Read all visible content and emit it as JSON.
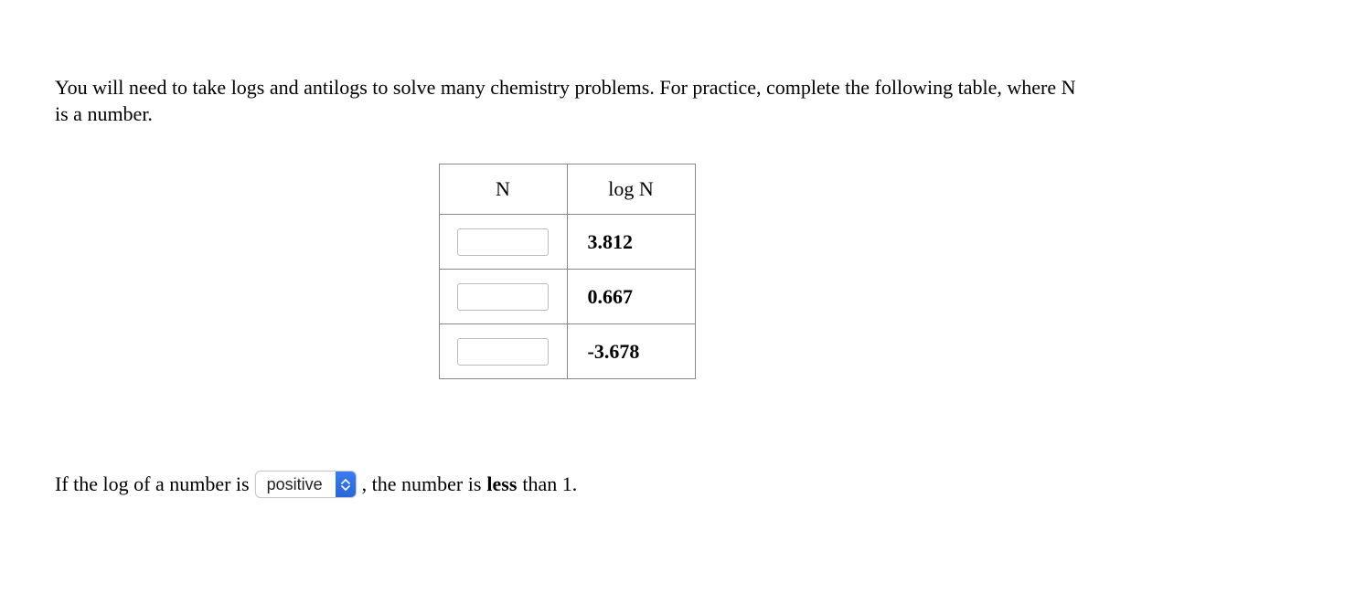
{
  "intro_text": "You will need to take logs and antilogs to solve many chemistry problems. For practice, complete the following table, where N is a number.",
  "table": {
    "headers": {
      "n": "N",
      "logn": "log N"
    },
    "rows": [
      {
        "n_value": "",
        "logn_value": "3.812"
      },
      {
        "n_value": "",
        "logn_value": "0.667"
      },
      {
        "n_value": "",
        "logn_value": "-3.678"
      }
    ]
  },
  "sentence": {
    "part1": "If the log of a number is",
    "select_value": "positive",
    "part2": ", the number is",
    "bold_word": "less",
    "part3": "than 1."
  }
}
